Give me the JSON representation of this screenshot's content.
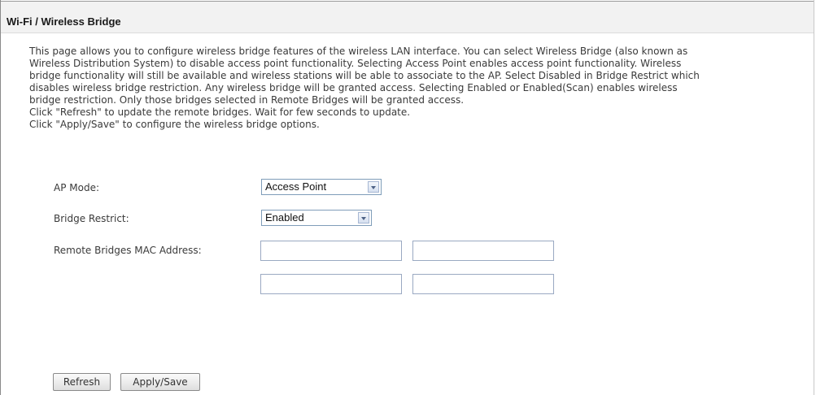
{
  "header": {
    "title": "Wi-Fi / Wireless Bridge"
  },
  "description": {
    "lines": [
      "This page allows you to configure wireless bridge features of the wireless LAN interface. You can select Wireless Bridge (also known as",
      "Wireless Distribution System) to disable access point functionality. Selecting Access Point enables access point functionality. Wireless",
      "bridge functionality will still be available and wireless stations will be able to associate to the AP. Select Disabled in Bridge Restrict which",
      "disables wireless bridge restriction. Any wireless bridge will be granted access. Selecting Enabled or Enabled(Scan) enables wireless",
      "bridge restriction. Only those bridges selected in Remote Bridges will be granted access.",
      "Click \"Refresh\" to update the remote bridges. Wait for few seconds to update.",
      "Click \"Apply/Save\" to configure the wireless bridge options."
    ]
  },
  "form": {
    "ap_mode": {
      "label": "AP Mode:",
      "value": "Access Point",
      "icon": "chevron-down-icon"
    },
    "bridge_restrict": {
      "label": "Bridge Restrict:",
      "value": "Enabled",
      "icon": "chevron-down-icon"
    },
    "remote_mac": {
      "label": "Remote Bridges MAC Address:",
      "values": [
        "",
        "",
        "",
        ""
      ]
    }
  },
  "buttons": {
    "refresh": "Refresh",
    "apply_save": "Apply/Save"
  }
}
